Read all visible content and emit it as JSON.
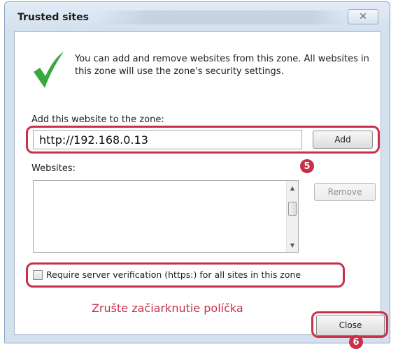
{
  "window": {
    "title": "Trusted sites",
    "close_glyph": "✕"
  },
  "info": {
    "text": "You can add and remove websites from this zone. All websites in this zone will use the zone's security settings.",
    "icon": "check-icon"
  },
  "add": {
    "label": "Add this website to the zone:",
    "url_value": "http://192.168.0.13",
    "button_label": "Add"
  },
  "websites": {
    "label": "Websites:",
    "items": [],
    "remove_label": "Remove"
  },
  "verification": {
    "label": "Require server verification (https:) for all sites in this zone",
    "checked": false
  },
  "annotations": {
    "step5": "5",
    "step6": "6",
    "note": "Zrušte začiarknutie políčka",
    "color": "#c8304a"
  },
  "footer": {
    "close_label": "Close"
  },
  "colors": {
    "check_green": "#3aa840",
    "frame": "#d4e0ee"
  }
}
